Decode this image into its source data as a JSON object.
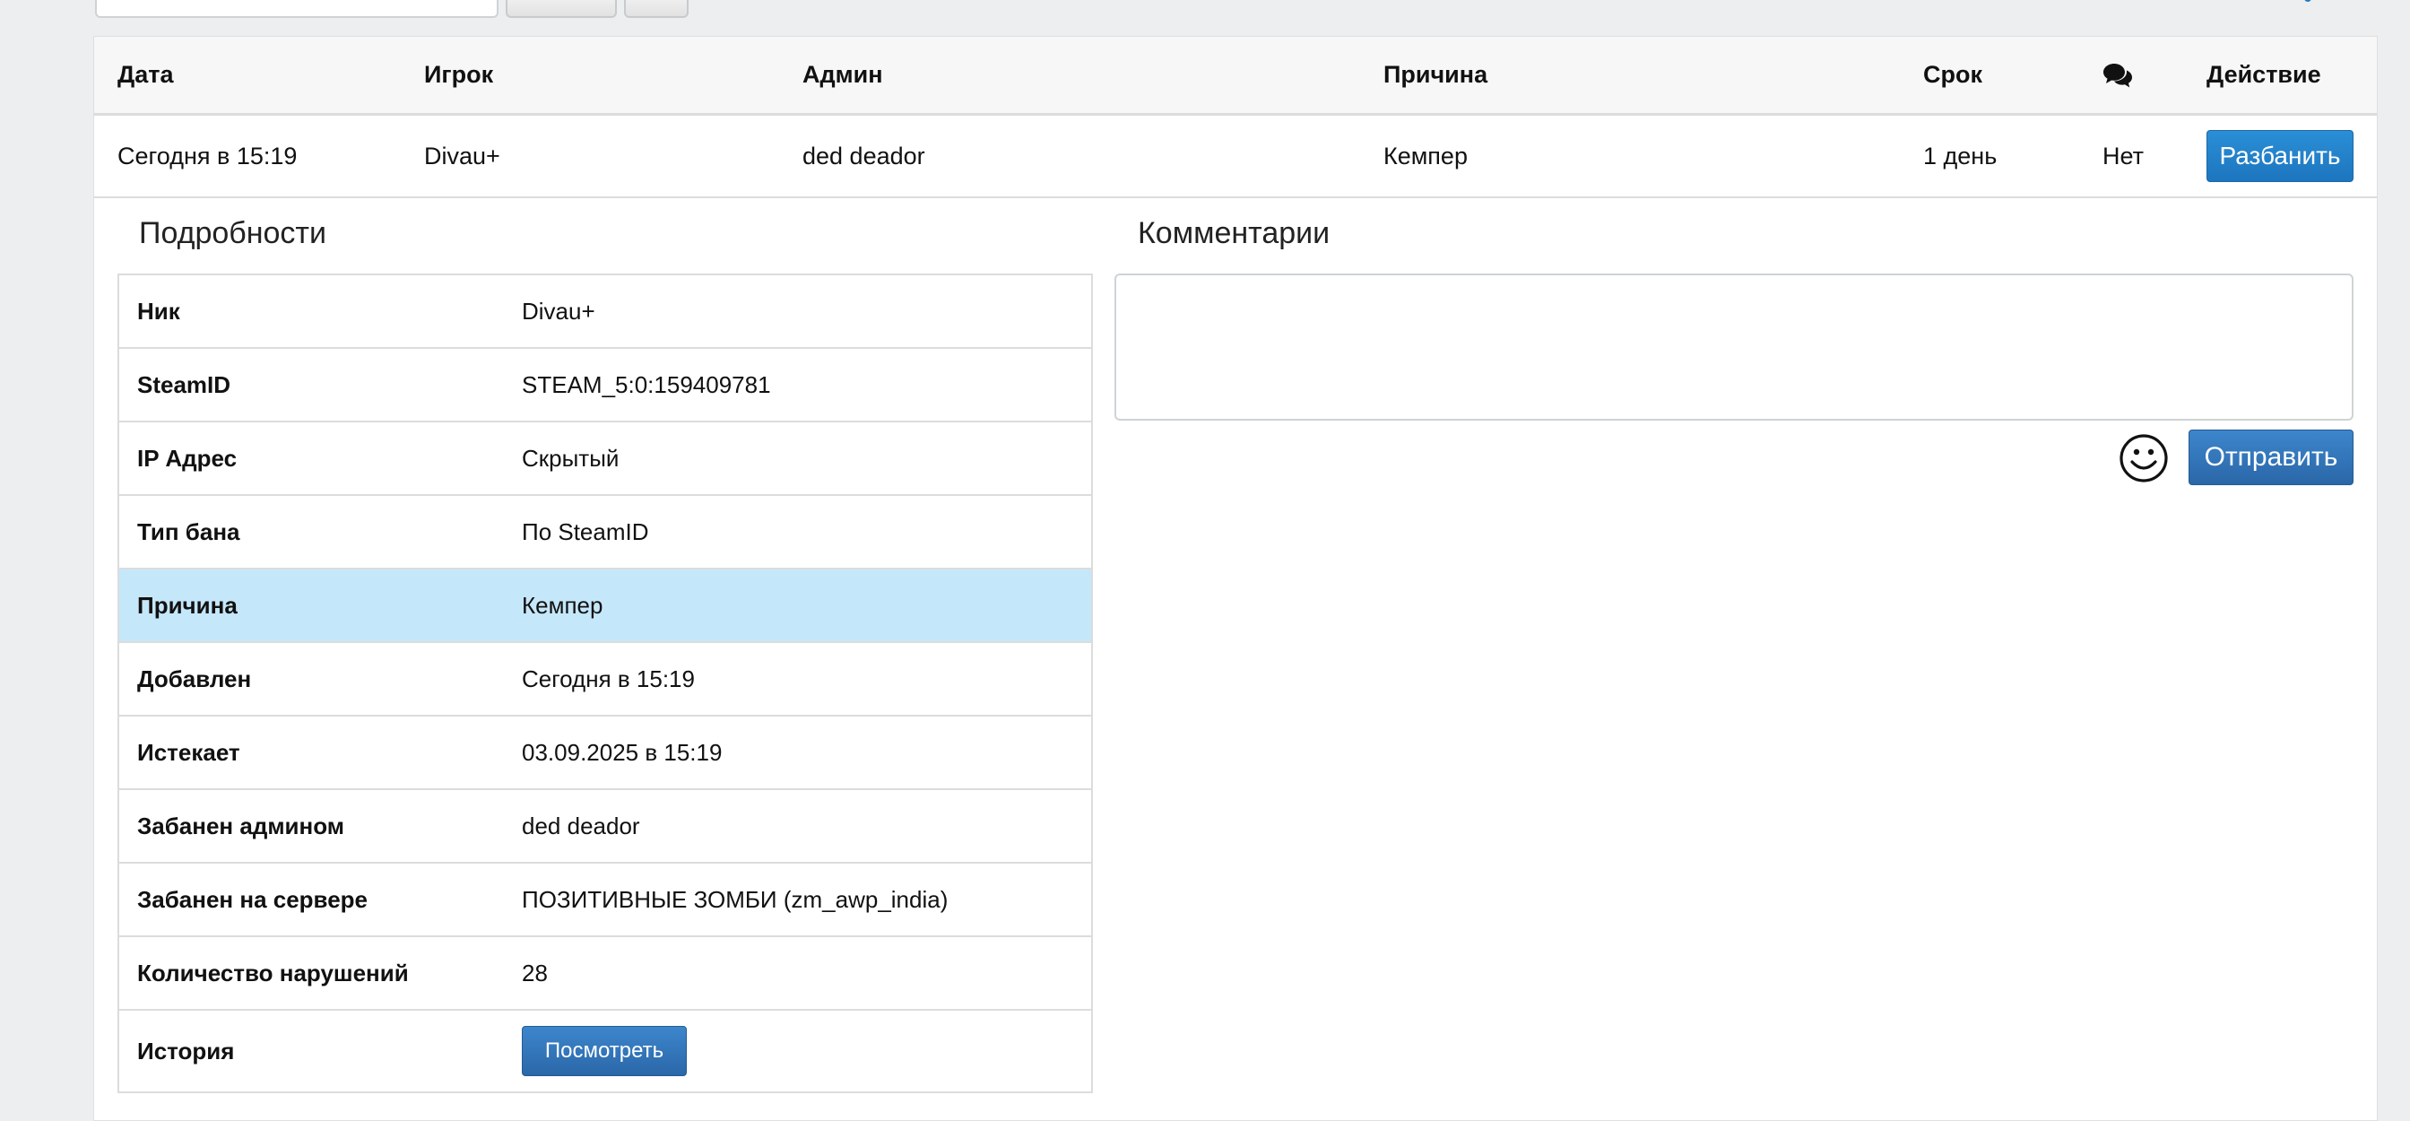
{
  "bans_table": {
    "headers": {
      "date": "Дата",
      "player": "Игрок",
      "admin": "Админ",
      "reason": "Причина",
      "term": "Срок",
      "comments_icon": "comments-icon",
      "action": "Действие"
    },
    "row": {
      "date": "Сегодня в 15:19",
      "player": "Divau+",
      "admin": "ded deador",
      "reason": "Кемпер",
      "term": "1 день",
      "comments": "Нет",
      "action_label": "Разбанить"
    }
  },
  "details": {
    "title": "Подробности",
    "rows": [
      {
        "label": "Ник",
        "value": "Divau+"
      },
      {
        "label": "SteamID",
        "value": "STEAM_5:0:159409781"
      },
      {
        "label": "IP Адрес",
        "value": "Скрытый"
      },
      {
        "label": "Тип бана",
        "value": "По SteamID"
      },
      {
        "label": "Причина",
        "value": "Кемпер"
      },
      {
        "label": "Добавлен",
        "value": "Сегодня в 15:19"
      },
      {
        "label": "Истекает",
        "value": "03.09.2025 в 15:19"
      },
      {
        "label": "Забанен админом",
        "value": "ded deador"
      },
      {
        "label": "Забанен на сервере",
        "value": "ПОЗИТИВНЫЕ ЗОМБИ (zm_awp_india)"
      },
      {
        "label": "Количество нарушений",
        "value": "28"
      }
    ],
    "history": {
      "label": "История",
      "button_label": "Посмотреть"
    }
  },
  "comments": {
    "title": "Комментарии",
    "input_value": "",
    "emoji_icon": "smiley-icon",
    "send_label": "Отправить"
  },
  "colors": {
    "accent": "#1d75bf",
    "highlight_row": "#c5e7fa"
  }
}
